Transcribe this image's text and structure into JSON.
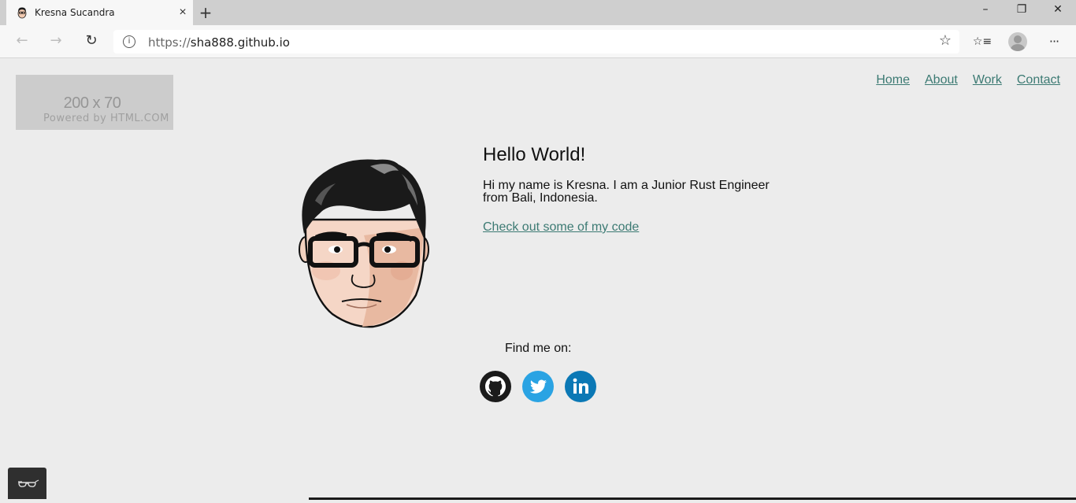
{
  "browser": {
    "tab": {
      "title": "Kresna Sucandra",
      "close_icon": "×",
      "favicon": "avatar-favicon"
    },
    "new_tab_icon": "+",
    "window_controls": {
      "minimize": "–",
      "maximize": "❐",
      "close": "✕"
    },
    "toolbar": {
      "back_icon": "←",
      "forward_icon": "→",
      "refresh_icon": "↻",
      "url_protocol": "https://",
      "url_host": "sha888.github.io",
      "info_icon": "i",
      "favorite_icon": "☆",
      "favorites_icon": "☆≡",
      "menu_icon": "···"
    }
  },
  "page": {
    "logo_placeholder": {
      "size_text": "200 x 70",
      "powered_text": "Powered by HTML.COM"
    },
    "nav": [
      {
        "label": "Home"
      },
      {
        "label": "About"
      },
      {
        "label": "Work"
      },
      {
        "label": "Contact"
      }
    ],
    "hero": {
      "heading": "Hello World!",
      "intro": "Hi my name is Kresna. I am a Junior Rust Engineer from Bali, Indonesia.",
      "code_link": "Check out some of my code"
    },
    "social": {
      "label": "Find me on:",
      "links": [
        {
          "name": "GitHub",
          "color": "#1b1b1b"
        },
        {
          "name": "Twitter",
          "color": "#2aa3e3"
        },
        {
          "name": "LinkedIn",
          "color": "#0b78b5"
        }
      ]
    },
    "colors": {
      "link": "#3c7a73",
      "background": "#ececec"
    }
  }
}
